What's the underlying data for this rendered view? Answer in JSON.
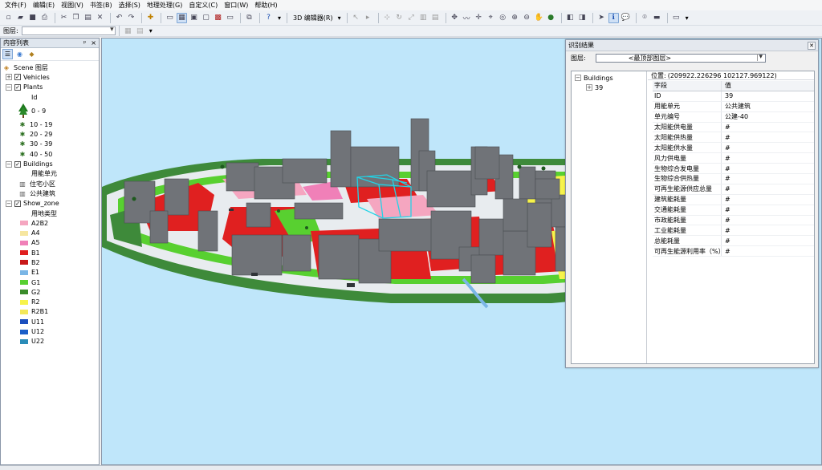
{
  "menu": [
    "文件(F)",
    "编辑(E)",
    "视图(V)",
    "书签(B)",
    "选择(S)",
    "地理处理(G)",
    "自定义(C)",
    "窗口(W)",
    "帮助(H)"
  ],
  "toolbar": {
    "editor_label": "3D 编辑器(R)",
    "layer_label": "图层:"
  },
  "toc": {
    "title": "内容列表",
    "pin": "ᵖ",
    "close": "×",
    "scene_label": "Scene 图层",
    "vehicles": "Vehicles",
    "plants": "Plants",
    "plants_field": "Id",
    "plant_classes": [
      "0 - 9",
      "10 - 19",
      "20 - 29",
      "30 - 39",
      "40 - 50"
    ],
    "buildings": "Buildings",
    "buildings_field": "用能单元",
    "building_classes": [
      "住宅小区",
      "公共建筑"
    ],
    "show_zone": "Show_zone",
    "zone_field": "用地类型",
    "zones": [
      {
        "label": "A2B2",
        "color": "#f5a6c0"
      },
      {
        "label": "A4",
        "color": "#f6e6a0"
      },
      {
        "label": "A5",
        "color": "#f080b8"
      },
      {
        "label": "B1",
        "color": "#e02020"
      },
      {
        "label": "B2",
        "color": "#c81818"
      },
      {
        "label": "E1",
        "color": "#7ab6e6"
      },
      {
        "label": "G1",
        "color": "#58d030"
      },
      {
        "label": "G2",
        "color": "#3a8c2a"
      },
      {
        "label": "R2",
        "color": "#f7f34a"
      },
      {
        "label": "R2B1",
        "color": "#f3e85a"
      },
      {
        "label": "U11",
        "color": "#1c4fbe"
      },
      {
        "label": "U12",
        "color": "#1a5ec8"
      },
      {
        "label": "U22",
        "color": "#2a8cb8"
      }
    ]
  },
  "identify": {
    "title": "识别结果",
    "layer_label": "图层:",
    "layer_value": "<最顶部图层>",
    "tree_layer": "Buildings",
    "tree_feature": "39",
    "location_label": "位置:",
    "location_value": "(209922.226296 102127.969122)",
    "columns": [
      "字段",
      "值"
    ],
    "rows": [
      {
        "field": "ID",
        "value": "39"
      },
      {
        "field": "用能单元",
        "value": "公共建筑"
      },
      {
        "field": "单元编号",
        "value": "公建-40"
      },
      {
        "field": "太阳能供电量",
        "value": "#"
      },
      {
        "field": "太阳能供热量",
        "value": "#"
      },
      {
        "field": "太阳能供水量",
        "value": "#"
      },
      {
        "field": "风力供电量",
        "value": "#"
      },
      {
        "field": "生物综合发电量",
        "value": "#"
      },
      {
        "field": "生物综合供热量",
        "value": "#"
      },
      {
        "field": "可再生能源供应总量",
        "value": "#"
      },
      {
        "field": "建筑能耗量",
        "value": "#"
      },
      {
        "field": "交通能耗量",
        "value": "#"
      },
      {
        "field": "市政能耗量",
        "value": "#"
      },
      {
        "field": "工业能耗量",
        "value": "#"
      },
      {
        "field": "总能耗量",
        "value": "#"
      },
      {
        "field": "可再生能源利用率（%）",
        "value": "#"
      }
    ]
  },
  "colors": {
    "sky": "#bfe6fa",
    "road": "#e8ecef",
    "green_belt": "#3e8a3a",
    "building": "#707378",
    "highlight": "#22d3e6"
  }
}
